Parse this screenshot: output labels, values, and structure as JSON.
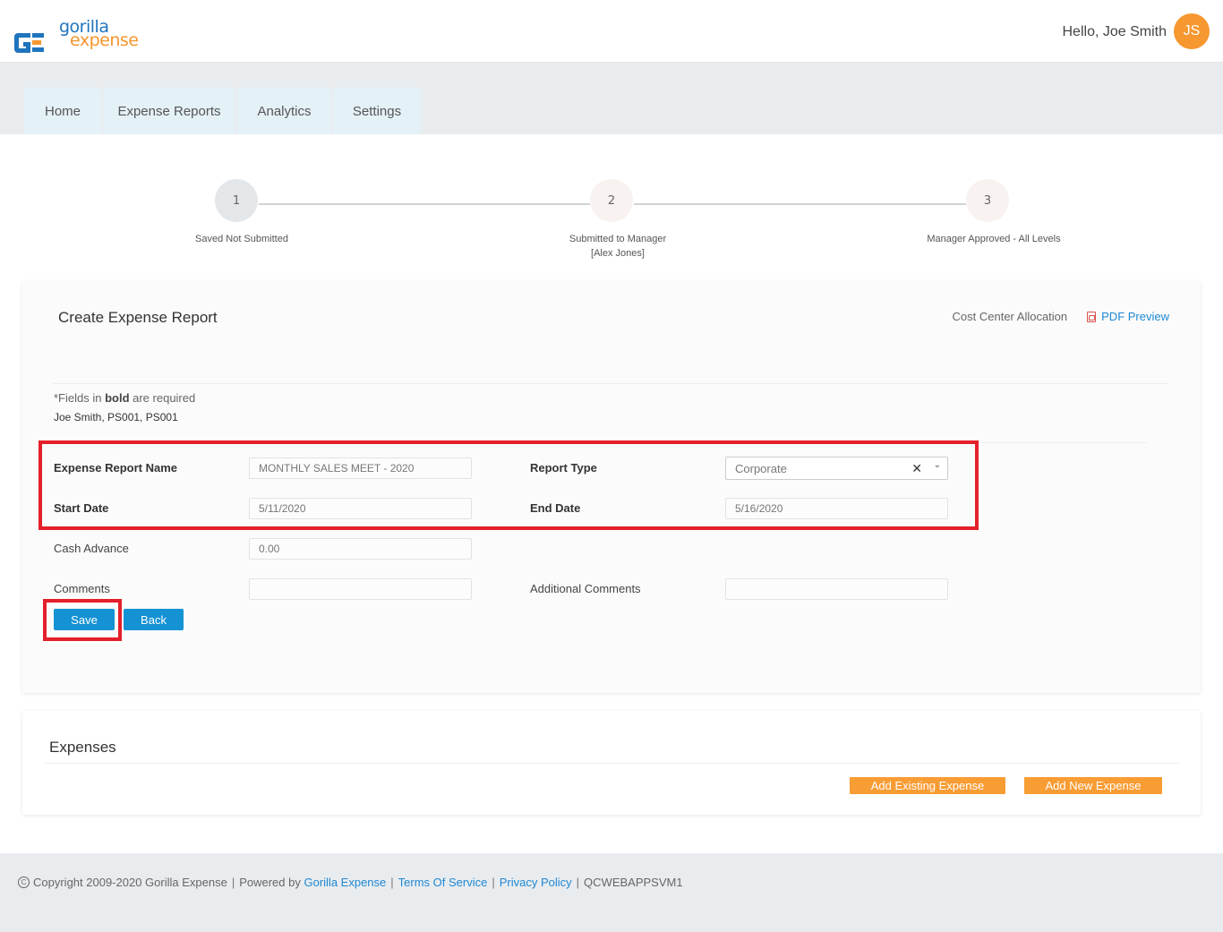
{
  "header": {
    "logo_top": "gorilla",
    "logo_bottom": "expense",
    "greeting": "Hello, Joe Smith",
    "avatar_initials": "JS"
  },
  "nav": {
    "tabs": [
      {
        "label": "Home"
      },
      {
        "label": "Expense Reports"
      },
      {
        "label": "Analytics"
      },
      {
        "label": "Settings"
      }
    ]
  },
  "stepper": {
    "steps": [
      {
        "number": "1",
        "label_line1": "Saved Not Submitted",
        "label_line2": ""
      },
      {
        "number": "2",
        "label_line1": "Submitted to Manager",
        "label_line2": "[Alex Jones]"
      },
      {
        "number": "3",
        "label_line1": "Manager Approved - All Levels",
        "label_line2": ""
      }
    ]
  },
  "report": {
    "title": "Create Expense Report",
    "cost_center_label": "Cost Center Allocation",
    "pdf_preview_label": "PDF Preview",
    "required_prefix": "*Fields in ",
    "required_bold": "bold",
    "required_suffix": " are required",
    "owner": "Joe Smith, PS001, PS001",
    "fields": {
      "report_name_label": "Expense Report Name",
      "report_name_value": "MONTHLY SALES MEET - 2020",
      "report_type_label": "Report Type",
      "report_type_value": "Corporate",
      "start_date_label": "Start Date",
      "start_date_value": "5/11/2020",
      "end_date_label": "End Date",
      "end_date_value": "5/16/2020",
      "cash_advance_label": "Cash Advance",
      "cash_advance_value": "0.00",
      "comments_label": "Comments",
      "comments_value": "",
      "additional_comments_label": "Additional Comments",
      "additional_comments_value": ""
    },
    "save_label": "Save",
    "back_label": "Back"
  },
  "expenses": {
    "title": "Expenses",
    "add_existing_label": "Add Existing Expense",
    "add_new_label": "Add New Expense"
  },
  "footer": {
    "copyright": "Copyright 2009-2020 Gorilla Expense",
    "powered_by": "Powered by",
    "powered_link": "Gorilla Expense",
    "terms": "Terms Of Service",
    "privacy": "Privacy Policy",
    "server": "QCWEBAPPSVM1"
  },
  "colors": {
    "brand_blue": "#1f74bd",
    "brand_orange": "#f7972f",
    "button_blue": "#1592d3",
    "highlight_red": "#e3202b"
  }
}
